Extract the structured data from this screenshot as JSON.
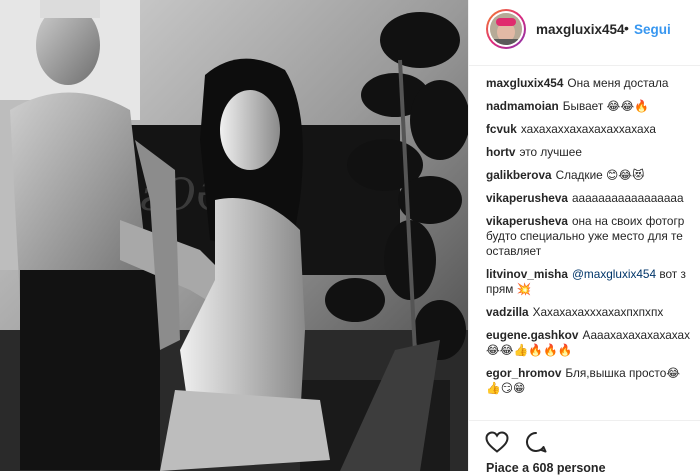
{
  "post": {
    "username": "maxgluxix454",
    "separator": "•",
    "follow_label": "Segui"
  },
  "comments": [
    {
      "user": "maxgluxix454",
      "text": "Она меня достала",
      "line2": ""
    },
    {
      "user": "nadmamoian",
      "text": "Бывает 😂😂🔥",
      "line2": ""
    },
    {
      "user": "fcvuk",
      "text": "хахахаххахахахаххахаха",
      "line2": ""
    },
    {
      "user": "hortv",
      "text": "это лучшее",
      "line2": ""
    },
    {
      "user": "galikberova",
      "text": "Сладкие 😊😂😻",
      "line2": ""
    },
    {
      "user": "vikaperusheva",
      "text": "ааааааааааааааааа",
      "line2": ""
    },
    {
      "user": "vikaperusheva",
      "text": "она на своих фотогр",
      "line2": "будто специально уже место для те",
      "line3": "оставляет"
    },
    {
      "user": "litvinov_misha",
      "mention": "@maxgluxix454",
      "text": "вот з",
      "line2": "прям 💥"
    },
    {
      "user": "vadzilla",
      "text": "Хахахахахххахахпхпхпх",
      "line2": ""
    },
    {
      "user": "eugene.gashkov",
      "text": "Аааахахахахахахах",
      "line2": "😂😂👍🔥🔥🔥"
    },
    {
      "user": "egor_hromov",
      "text": "Бля,вышка просто😂",
      "line2": "👍😏😁"
    }
  ],
  "actions": {
    "likes_text": "Piace a 608 persone"
  },
  "icons": {
    "like": "heart-outline-icon",
    "comment": "comment-bubble-icon"
  }
}
